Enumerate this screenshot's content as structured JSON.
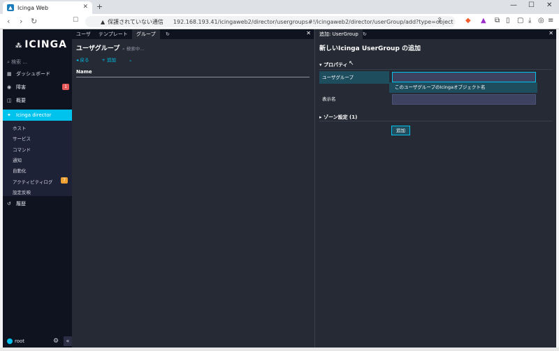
{
  "browser": {
    "tab_title": "Icinga Web",
    "tab_close": "✕",
    "new_tab": "+",
    "insecure_label": "保護されていない通信",
    "url": "192.168.193.41/icingaweb2/director/usergroups#!/icingaweb2/director/userGroup/add?type=object"
  },
  "sidebar": {
    "logo": "ICINGA",
    "search_placeholder": "検索 ...",
    "items": [
      {
        "label": "ダッシュボード"
      },
      {
        "label": "障害",
        "badge": "1"
      },
      {
        "label": "概要"
      },
      {
        "label": "Icinga director"
      }
    ],
    "subitems": [
      {
        "label": "ホスト"
      },
      {
        "label": "サービス"
      },
      {
        "label": "コマンド"
      },
      {
        "label": "通知"
      },
      {
        "label": "自動化"
      },
      {
        "label": "アクティビティログ",
        "badge": "7"
      },
      {
        "label": "設定反映"
      }
    ],
    "history": "履歴",
    "user": "root"
  },
  "left_pane": {
    "tabs": [
      "ユーザ",
      "テンプレート",
      "グループ"
    ],
    "title": "ユーザグループ",
    "search_placeholder": "検索中...",
    "back": "戻る",
    "add": "追加",
    "column_name": "Name"
  },
  "right_pane": {
    "tab": "追加: UserGroup",
    "title": "新しいIcinga UserGroup の追加",
    "section_properties": "プロパティ",
    "field_usergroup": "ユーザグループ",
    "field_usergroup_hint": "このユーザグループのIcingaオブジェクト名",
    "field_display_name": "表示名",
    "section_zone": "ゾーン設定 (1)",
    "submit": "追加"
  },
  "colors": {
    "accent": "#00c3ed",
    "sidebar_bg": "#0f1320",
    "content_bg": "#262a35",
    "badge_red": "#e85a5a",
    "badge_orange": "#f0a030"
  }
}
